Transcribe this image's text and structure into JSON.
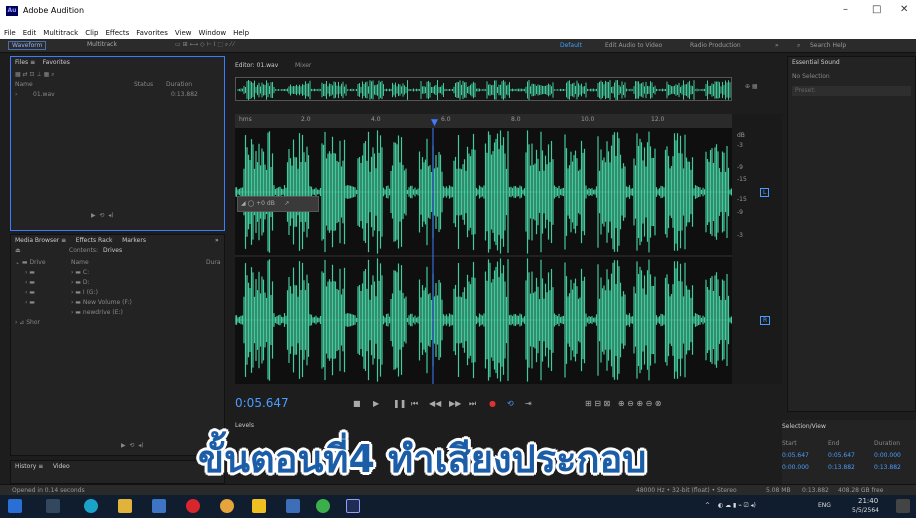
{
  "window": {
    "title": "Adobe Audition",
    "app_icon": "Au",
    "minimize": "–",
    "maximize": "□",
    "close": "✕"
  },
  "menu": [
    "File",
    "Edit",
    "Multitrack",
    "Clip",
    "Effects",
    "Favorites",
    "View",
    "Window",
    "Help"
  ],
  "toolbar": {
    "waveform": "Waveform",
    "multitrack": "Multitrack",
    "workspaces": [
      "Default",
      "Edit Audio to Video",
      "Radio Production"
    ],
    "more": "»",
    "search_placeholder": "Search Help"
  },
  "files_panel": {
    "tabs": [
      "Files",
      "Favorites"
    ],
    "col_name": "Name",
    "col_status": "Status",
    "col_duration": "Duration",
    "rows": [
      {
        "name": "01.wav",
        "duration": "0:13.882"
      }
    ]
  },
  "media_browser": {
    "tabs": [
      "Media Browser",
      "Effects Rack",
      "Markers"
    ],
    "contents_label": "Contents:",
    "contents_value": "Drives",
    "col_name": "Name",
    "col_dur": "Dura",
    "left_tree": [
      "Drive",
      "",
      "",
      "",
      "",
      "Shor"
    ],
    "drives": [
      "C:",
      "D:",
      "I (G:)",
      "New Volume (F:)",
      "newdrive (E:)"
    ]
  },
  "history": {
    "tabs": [
      "History",
      "Video"
    ],
    "status": "Opened in 0.14 seconds"
  },
  "editor": {
    "tab": "Editor: 01.wav",
    "mixer": "Mixer",
    "ruler_unit": "hms",
    "ruler": [
      "2.0",
      "4.0",
      "6.0",
      "8.0",
      "10.0",
      "12.0"
    ],
    "db_labels": [
      "dB",
      "-3",
      "-9",
      "-15",
      "-15",
      "-9",
      "-3"
    ],
    "channel_l": "L",
    "channel_r": "R",
    "hud_gain": "+0 dB"
  },
  "transport": {
    "timecode": "0:05.647",
    "buttons": [
      "■",
      "▶",
      "❚❚",
      "⏮",
      "◀◀",
      "▶▶",
      "⏭",
      "●",
      "⟲",
      "⇥"
    ]
  },
  "essential_sound": {
    "title": "Essential Sound",
    "no_selection": "No Selection",
    "preset": "Preset:"
  },
  "levels": {
    "title": "Levels"
  },
  "selection": {
    "title": "Selection/View",
    "cols": [
      "Start",
      "End",
      "Duration"
    ],
    "selection_row": [
      "0:05.647",
      "0:05.647",
      "0:00.000"
    ],
    "view_row": [
      "0:00.000",
      "0:13.882",
      "0:13.882"
    ]
  },
  "statusbar": {
    "format": "48000 Hz • 32-bit (float) • Stereo",
    "size": "5.08 MB",
    "duration": "0:13.882",
    "free": "408.28 GB free"
  },
  "caption": "ขั้นตอนที่4 ทำเสียงประกอบ",
  "taskbar": {
    "time": "21:40",
    "date": "5/5/2564",
    "lang": "ENG",
    "tray": "^"
  },
  "colors": {
    "waveform": "#43c99c",
    "accent": "#3fa0ff",
    "caption": "#1c5da8",
    "playhead": "#3c7cff"
  }
}
